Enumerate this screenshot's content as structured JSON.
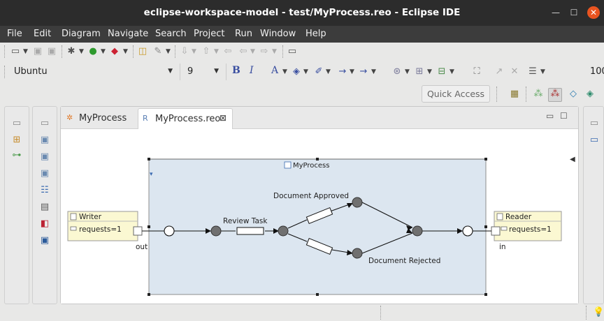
{
  "window": {
    "title": "eclipse-workspace-model - test/MyProcess.reo - Eclipse IDE"
  },
  "menu": [
    "File",
    "Edit",
    "Diagram",
    "Navigate",
    "Search",
    "Project",
    "Run",
    "Window",
    "Help"
  ],
  "format_toolbar": {
    "font_name": "Ubuntu",
    "font_size": "9",
    "bold": "B",
    "italic": "I",
    "font_color": "A",
    "zoom": "100"
  },
  "quick_access": {
    "label": "Quick Access"
  },
  "editor": {
    "tabs": [
      {
        "label": "MyProcess",
        "active": false
      },
      {
        "label": "MyProcess.reo",
        "active": true,
        "close": "⊠"
      }
    ]
  },
  "diagram": {
    "container_title": "MyProcess",
    "writer": {
      "title": "Writer",
      "port_label": "requests=1",
      "node_label": "out"
    },
    "reader": {
      "title": "Reader",
      "port_label": "requests=1",
      "node_label": "in"
    },
    "labels": {
      "review": "Review Task",
      "approved": "Document Approved",
      "rejected": "Document Rejected"
    }
  },
  "icons": {
    "titlebar": [
      "minimize-icon",
      "maximize-icon",
      "close-icon"
    ],
    "accent_close": "#e95420",
    "diagram_fill": "#dce6f0",
    "component_fill": "#fbf8d2"
  }
}
